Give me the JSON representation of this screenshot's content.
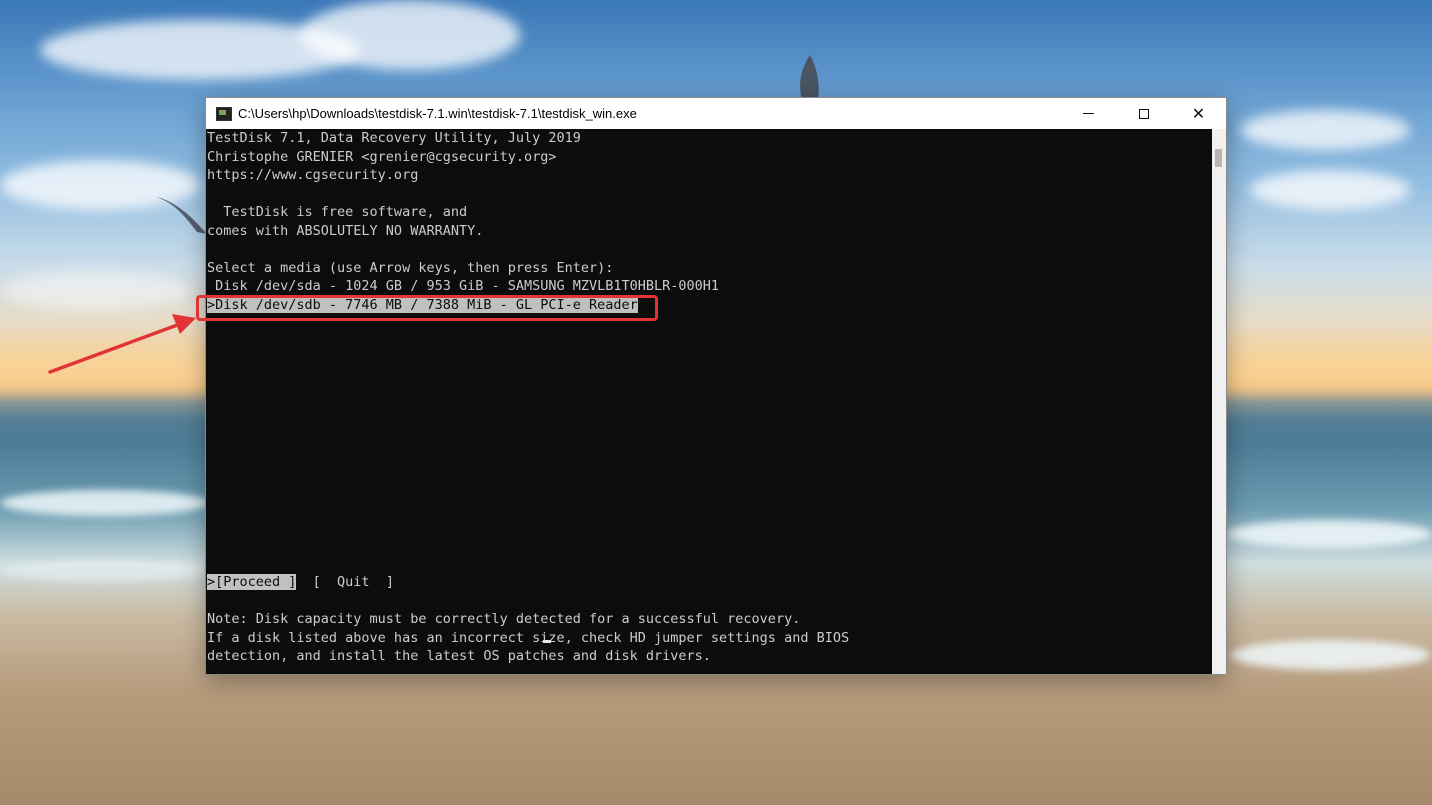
{
  "window": {
    "title": "C:\\Users\\hp\\Downloads\\testdisk-7.1.win\\testdisk-7.1\\testdisk_win.exe",
    "controls": {
      "minimize": "minimize",
      "maximize": "maximize",
      "close": "✕"
    }
  },
  "console": {
    "header": [
      "TestDisk 7.1, Data Recovery Utility, July 2019",
      "Christophe GRENIER <grenier@cgsecurity.org>",
      "https://www.cgsecurity.org"
    ],
    "license": [
      "  TestDisk is free software, and",
      "comes with ABSOLUTELY NO WARRANTY."
    ],
    "prompt": "Select a media (use Arrow keys, then press Enter):",
    "media": [
      {
        "label": " Disk /dev/sda - 1024 GB / 953 GiB - SAMSUNG MZVLB1T0HBLR-000H1",
        "selected": false
      },
      {
        "label": ">Disk /dev/sdb - 7746 MB / 7388 MiB - GL PCI-e Reader",
        "selected": true
      }
    ],
    "actions": {
      "proceed": ">[Proceed ]",
      "separator": "  [  ",
      "quit": "Quit",
      "quit_close": "  ]"
    },
    "note": [
      "Note: Disk capacity must be correctly detected for a successful recovery.",
      "If a disk listed above has an incorrect size, check HD jumper settings and BIOS",
      "detection, and install the latest OS patches and disk drivers."
    ]
  },
  "annotation": {
    "color": "#e23434",
    "icon": "red-arrow-icon"
  }
}
